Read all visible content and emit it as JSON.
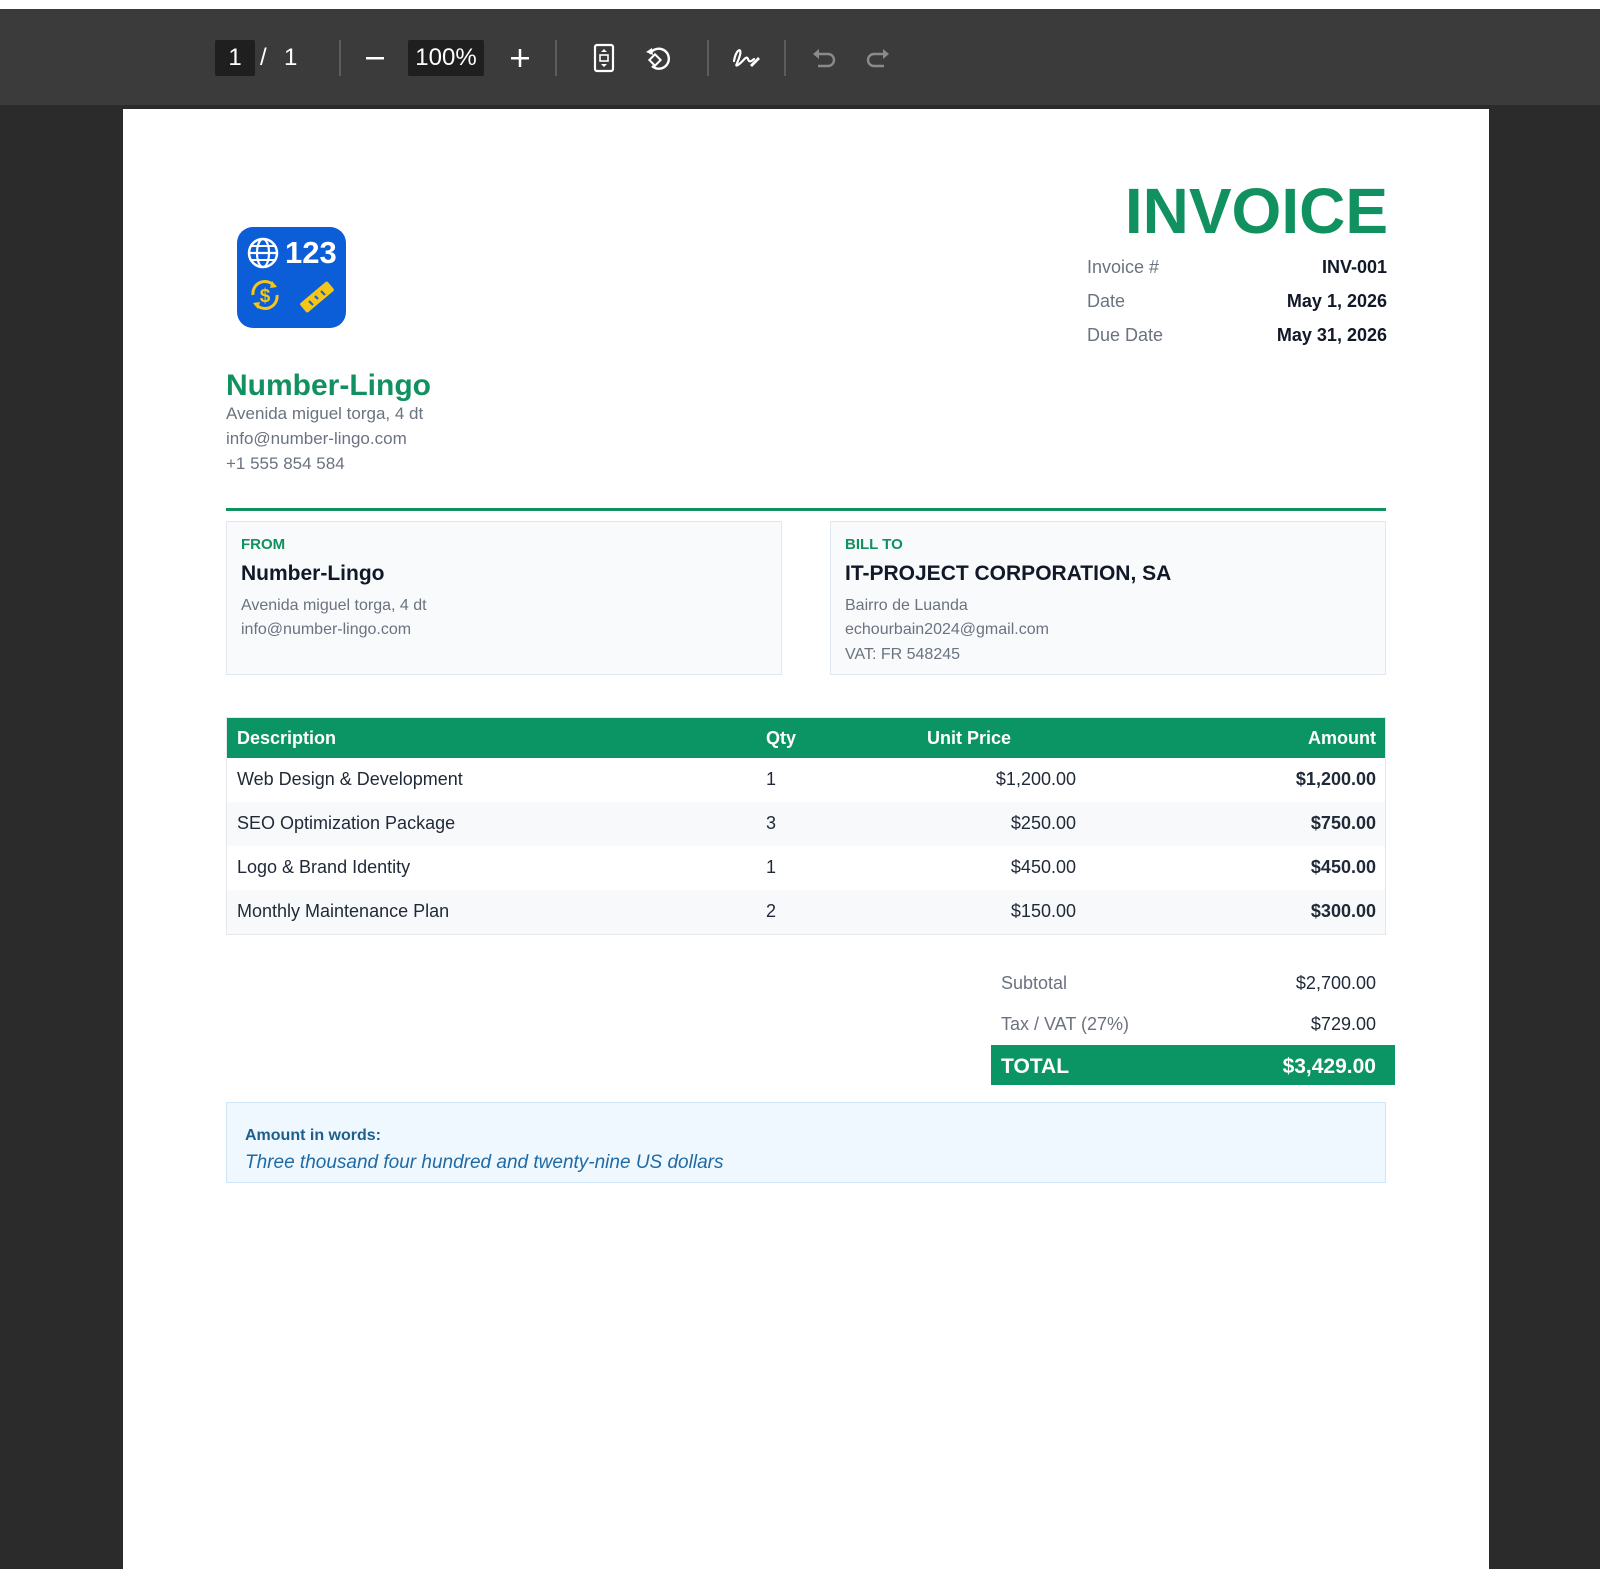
{
  "toolbar": {
    "current_page": "1",
    "page_separator": "/",
    "total_pages": "1",
    "zoom": "100%",
    "icons": [
      "zoom-out-icon",
      "zoom-in-icon",
      "fit-page-icon",
      "rotate-icon",
      "sign-icon",
      "undo-icon",
      "redo-icon"
    ]
  },
  "invoice": {
    "title": "INVOICE",
    "meta": [
      {
        "label": "Invoice #",
        "value": "INV-001"
      },
      {
        "label": "Date",
        "value": "May 1, 2026"
      },
      {
        "label": "Due Date",
        "value": "May 31, 2026"
      }
    ],
    "logo": {
      "text": "123"
    },
    "company": {
      "name": "Number-Lingo",
      "address": "Avenida miguel torga, 4 dt",
      "email": "info@number-lingo.com",
      "phone": "+1 555 854 584"
    },
    "from": {
      "label": "FROM",
      "name": "Number-Lingo",
      "address": "Avenida miguel torga, 4 dt",
      "email": "info@number-lingo.com"
    },
    "bill_to": {
      "label": "BILL TO",
      "name": "IT-PROJECT CORPORATION, SA",
      "address": "Bairro de Luanda",
      "email": "echourbain2024@gmail.com",
      "vat": "VAT: FR 548245"
    },
    "table": {
      "headers": {
        "description": "Description",
        "qty": "Qty",
        "unit_price": "Unit Price",
        "amount": "Amount"
      },
      "rows": [
        {
          "description": "Web Design & Development",
          "qty": "1",
          "unit_price": "$1,200.00",
          "amount": "$1,200.00"
        },
        {
          "description": "SEO Optimization Package",
          "qty": "3",
          "unit_price": "$250.00",
          "amount": "$750.00"
        },
        {
          "description": "Logo & Brand Identity",
          "qty": "1",
          "unit_price": "$450.00",
          "amount": "$450.00"
        },
        {
          "description": "Monthly Maintenance Plan",
          "qty": "2",
          "unit_price": "$150.00",
          "amount": "$300.00"
        }
      ]
    },
    "totals": {
      "subtotal_label": "Subtotal",
      "subtotal_value": "$2,700.00",
      "tax_label": "Tax / VAT (27%)",
      "tax_value": "$729.00",
      "total_label": "TOTAL",
      "total_value": "$3,429.00"
    },
    "amount_in_words": {
      "label": "Amount in words:",
      "text": "Three thousand four hundred and twenty-nine US dollars"
    }
  },
  "colors": {
    "accent_green": "#0b9464",
    "toolbar_bg": "#3b3b3b",
    "viewer_bg": "#2b2b2b",
    "logo_blue": "#0b5ed7",
    "logo_yellow": "#f5c518"
  }
}
